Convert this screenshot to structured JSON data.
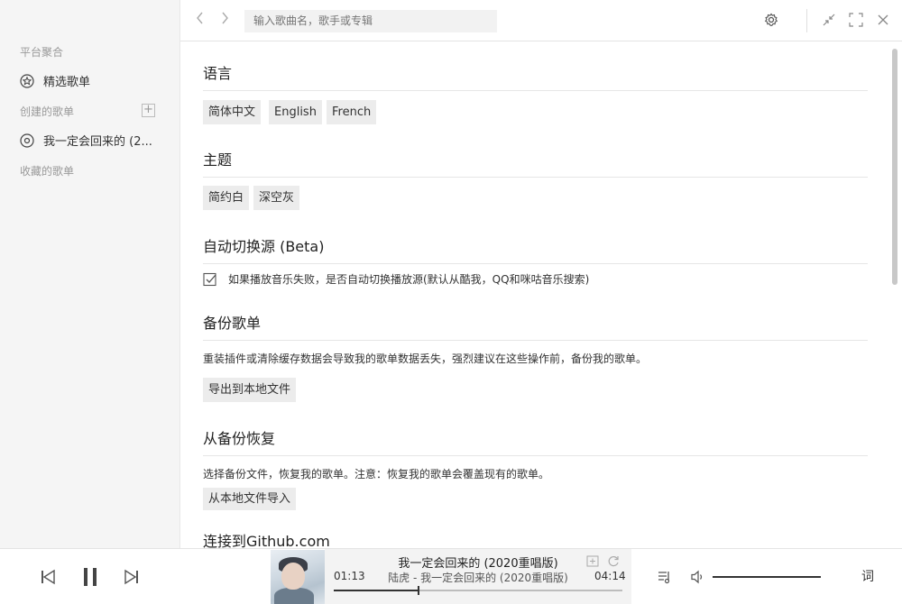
{
  "sidebar": {
    "platform_section": "平台聚合",
    "featured_label": "精选歌单",
    "created_section": "创建的歌单",
    "created_items": [
      "我一定会回来的 (2..."
    ],
    "favorite_section": "收藏的歌单"
  },
  "topbar": {
    "search_placeholder": "输入歌曲名，歌手或专辑"
  },
  "settings": {
    "language": {
      "title": "语言",
      "options": [
        "简体中文",
        "English",
        "French"
      ]
    },
    "theme": {
      "title": "主题",
      "options": [
        "简约白",
        "深空灰"
      ]
    },
    "autoswitch": {
      "title": "自动切换源 (Beta)",
      "checked": true,
      "label": "如果播放音乐失败，是否自动切换播放源(默认从酷我，QQ和咪咕音乐搜索)"
    },
    "backup": {
      "title": "备份歌单",
      "desc": "重装插件或清除缓存数据会导致我的歌单数据丢失，强烈建议在这些操作前，备份我的歌单。",
      "button": "导出到本地文件"
    },
    "restore": {
      "title": "从备份恢复",
      "desc": "选择备份文件，恢复我的歌单。注意：恢复我的歌单会覆盖现有的歌单。",
      "button": "从本地文件导入"
    },
    "github": {
      "title": "连接到Github.com"
    }
  },
  "player": {
    "title": "我一定会回来的 (2020重唱版)",
    "artist_line": "陆虎 - 我一定会回来的 (2020重唱版)",
    "current_time": "01:13",
    "total_time": "04:14",
    "progress_fraction": 0.29,
    "volume_fraction": 1.0,
    "lyric_button": "词"
  },
  "colors": {
    "accent": "#333333",
    "sidebar_bg": "#f5f5f5",
    "chip_bg": "#ececec"
  }
}
